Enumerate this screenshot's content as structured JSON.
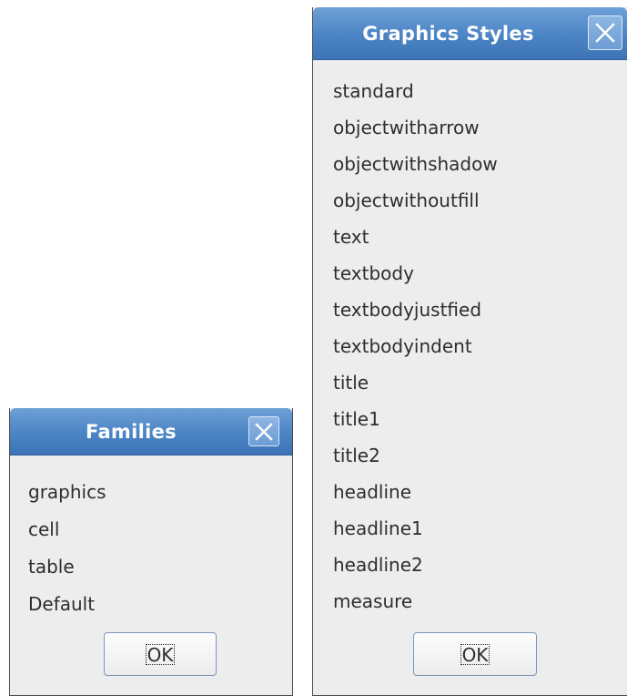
{
  "families": {
    "title": "Families",
    "close_icon": "close-x-icon",
    "items": [
      "graphics",
      "cell",
      "table",
      "Default"
    ],
    "ok_label": "OK"
  },
  "graphics_styles": {
    "title": "Graphics Styles",
    "close_icon": "close-x-icon",
    "items": [
      "standard",
      "objectwitharrow",
      "objectwithshadow",
      "objectwithoutfill",
      "text",
      "textbody",
      "textbodyjustfied",
      "textbodyindent",
      "title",
      "title1",
      "title2",
      "headline",
      "headline1",
      "headline2",
      "measure"
    ],
    "ok_label": "OK"
  },
  "colors": {
    "titlebar": "#4b84c4",
    "dialog_bg": "#ededed",
    "text": "#2e2e2e"
  }
}
